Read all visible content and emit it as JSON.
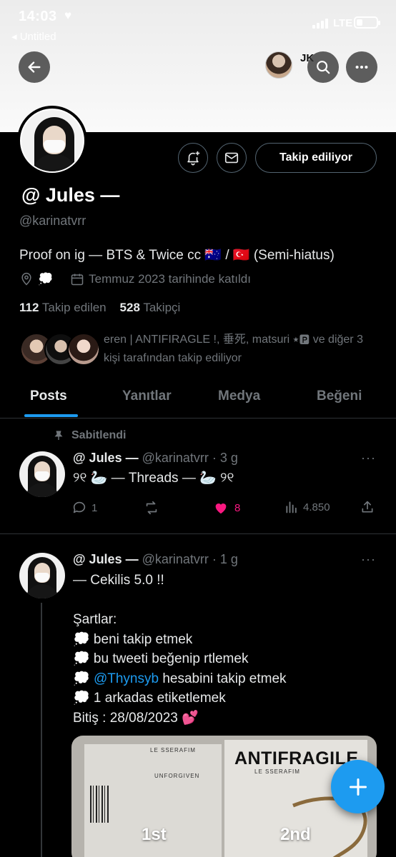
{
  "status_bar": {
    "time": "14:03",
    "heart": "♥",
    "back_app": "◂ Untitled",
    "network": "LTE"
  },
  "header": {
    "viewer_name": "JK"
  },
  "profile": {
    "display_name": "@ Jules —",
    "handle": "@karinatvrr",
    "bio": "Proof on ig — BTS & Twice cc 🇦🇺 / 🇹🇷  (Semi-hiatus)",
    "location": "💭",
    "joined": "Temmuz 2023 tarihinde katıldı",
    "following_count": "112",
    "following_label": "Takip edilen",
    "followers_count": "528",
    "followers_label": "Takipçi",
    "follow_button": "Takip ediliyor",
    "followed_by": "eren | ANTIFIRAGLE !, 垂死, matsuri ⭑🅿 ve diğer 3 kişi tarafından takip ediliyor"
  },
  "tabs": [
    {
      "label": "Posts",
      "active": true
    },
    {
      "label": "Yanıtlar",
      "active": false
    },
    {
      "label": "Medya",
      "active": false
    },
    {
      "label": "Beğeni",
      "active": false
    }
  ],
  "pinned_label": "Sabitlendi",
  "tweets": [
    {
      "name": "@ Jules —",
      "meta": "@karinatvrr · 3 g",
      "text": "୨୧ 🦢 — Threads  — 🦢 ୨୧",
      "replies": "1",
      "likes": "8",
      "views": "4.850"
    },
    {
      "name": "@ Jules —",
      "meta": "@karinatvrr · 1 g",
      "line1": "— Cekilis 5.0 !!",
      "line2": "Şartlar:",
      "line3": "💭 beni takip etmek",
      "line4": "💭 bu tweeti beğenip rtlemek",
      "line5_pre": "💭 ",
      "line5_link": "@Thynsyb",
      "line5_post": " hesabini takip etmek",
      "line6": "💭 1 arkadas etiketlemek",
      "line7": "Bitiş : 28/08/2023 💕",
      "media": {
        "left_title": "LE SSERAFIM",
        "left_sub": "UNFORGIVEN",
        "right_title": "ANTIFRAGILE",
        "right_sub": "LE SSERAFIM",
        "label_left": "1st",
        "label_right": "2nd"
      }
    }
  ],
  "colors": {
    "accent": "#1d9bf0",
    "like": "#f91880",
    "muted": "#71767b"
  }
}
